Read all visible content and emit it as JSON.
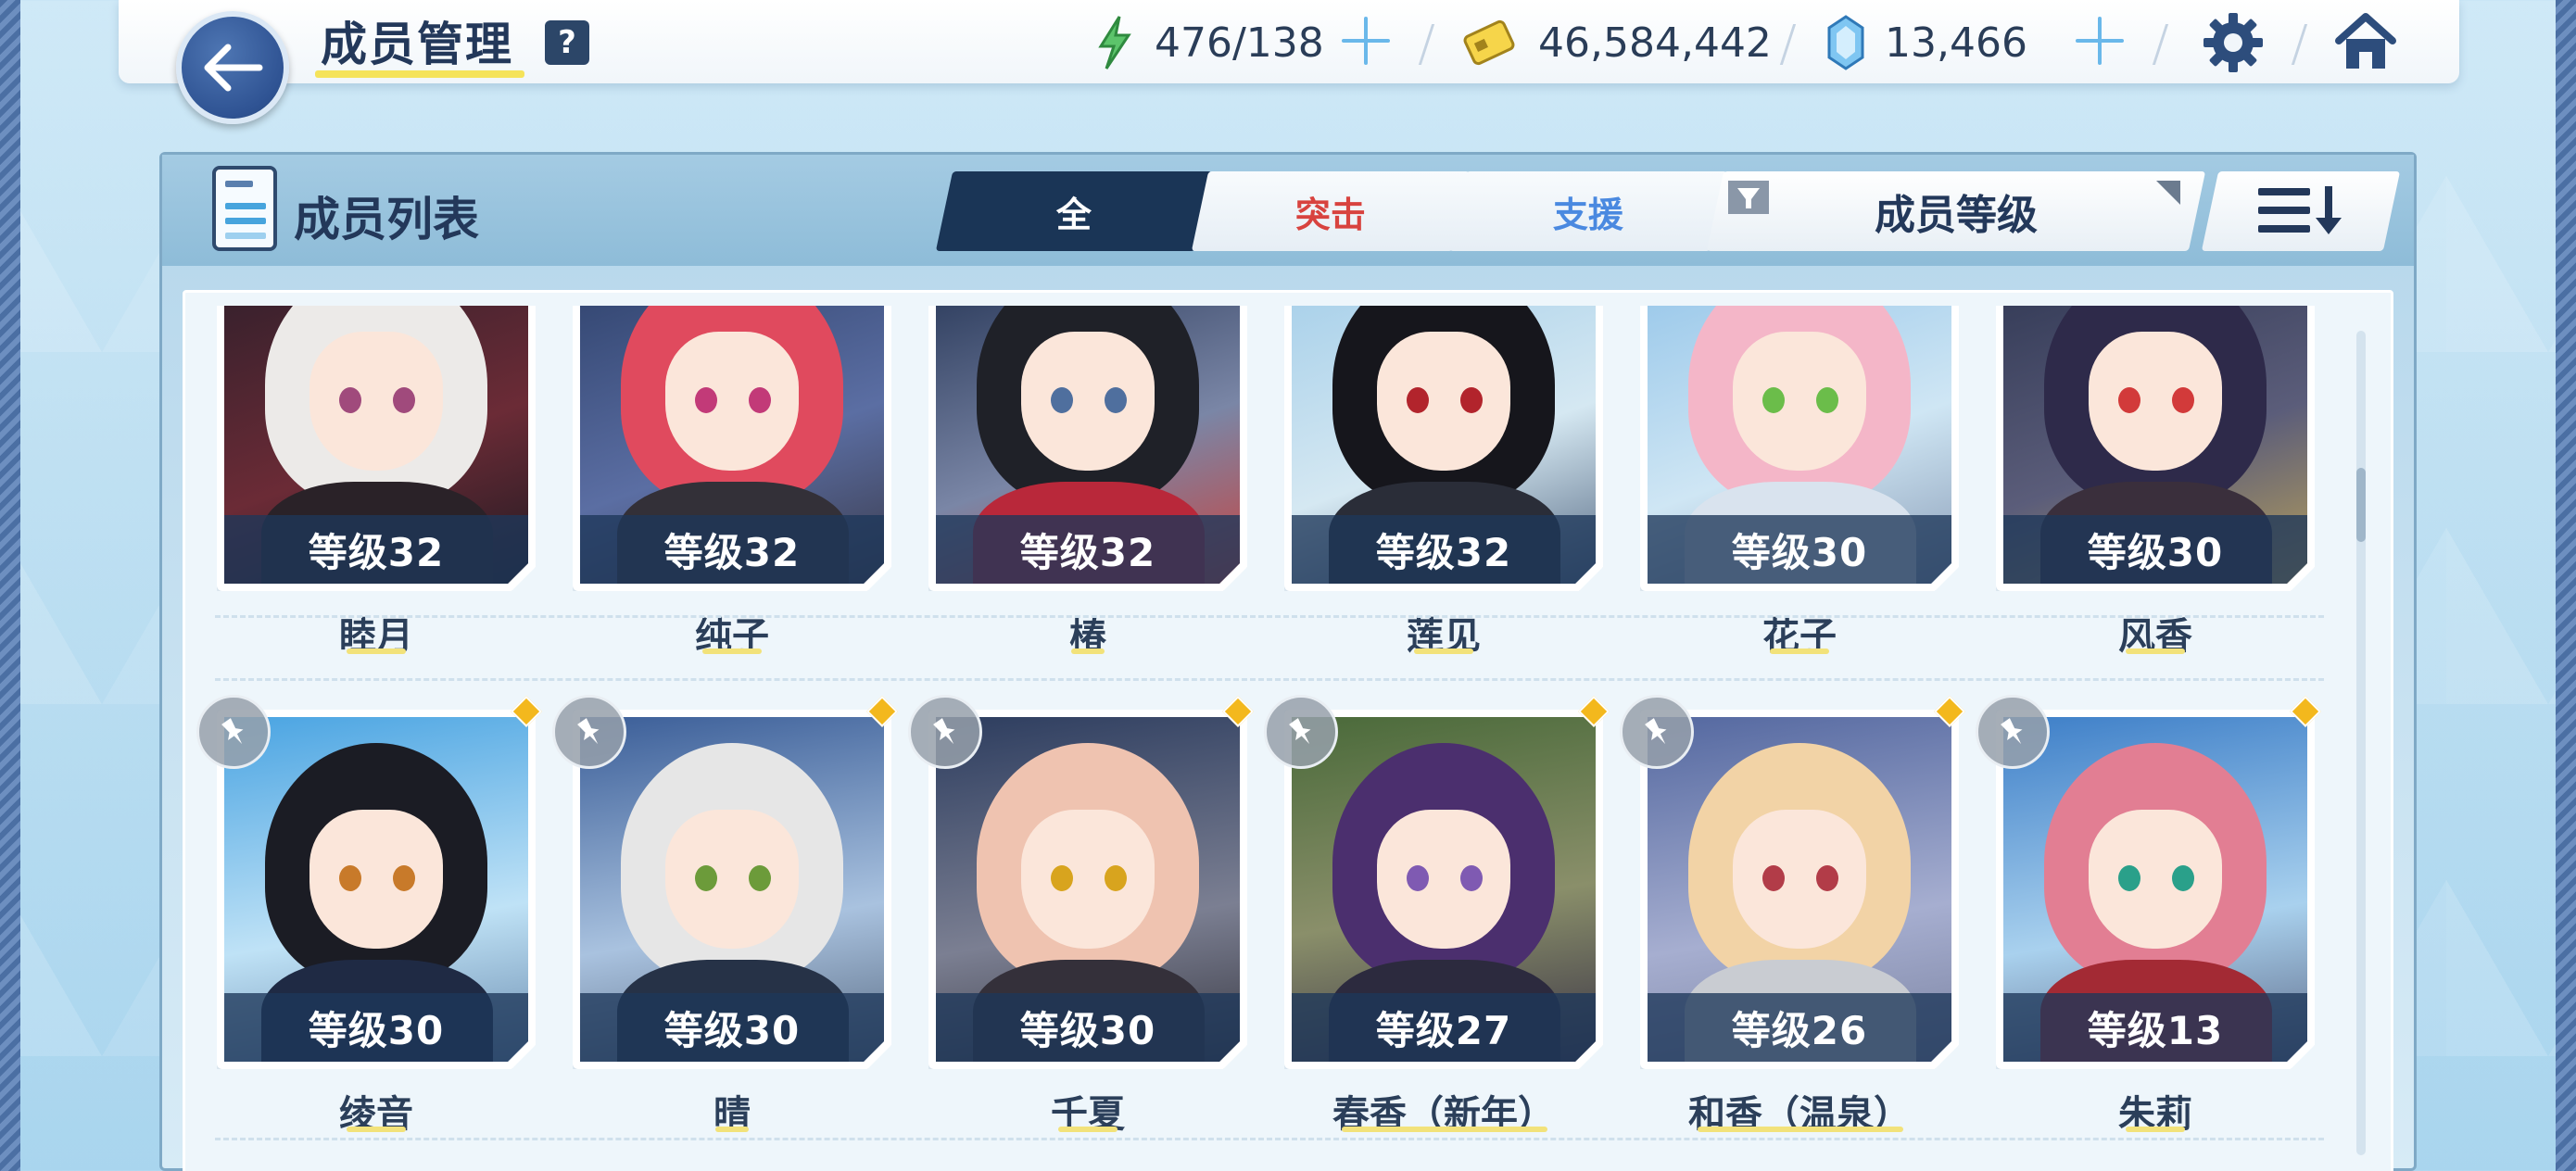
{
  "header": {
    "title": "成员管理",
    "help_label": "?",
    "ap": "476/138",
    "credits": "46,584,442",
    "gems": "13,466"
  },
  "panel": {
    "title": "成员列表",
    "tabs": [
      {
        "label": "全",
        "active": true
      },
      {
        "label": "突击",
        "active": false
      },
      {
        "label": "支援",
        "active": false
      }
    ],
    "sort_label": "成员等级"
  },
  "colors": {
    "accent_dark": "#1a3556",
    "strike_red": "#d8433f",
    "support_blue": "#4a89e0",
    "underline_yellow": "#f2e27a",
    "diamond_gold": "#f3b81d"
  },
  "members_row1": [
    {
      "name": "睦月",
      "level": "等级32"
    },
    {
      "name": "纯子",
      "level": "等级32"
    },
    {
      "name": "椿",
      "level": "等级32"
    },
    {
      "name": "莲见",
      "level": "等级32"
    },
    {
      "name": "花子",
      "level": "等级30"
    },
    {
      "name": "风香",
      "level": "等级30"
    }
  ],
  "members_row2": [
    {
      "name": "绫音",
      "level": "等级30"
    },
    {
      "name": "晴",
      "level": "等级30"
    },
    {
      "name": "千夏",
      "level": "等级30"
    },
    {
      "name": "春香（新年）",
      "level": "等级27"
    },
    {
      "name": "和香（温泉）",
      "level": "等级26"
    },
    {
      "name": "朱莉",
      "level": "等级13"
    }
  ]
}
